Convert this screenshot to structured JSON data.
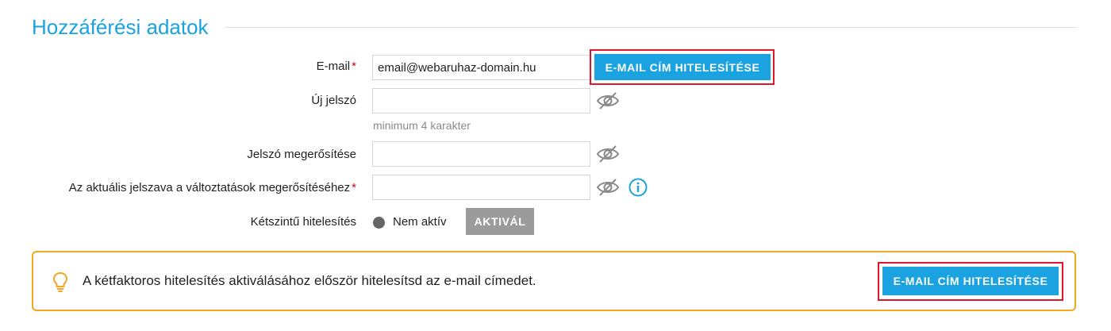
{
  "section": {
    "title": "Hozzáférési adatok"
  },
  "form": {
    "email": {
      "label": "E-mail",
      "required_mark": "*",
      "value": "email@webaruhaz-domain.hu",
      "verify_button": "E-MAIL CÍM HITELESÍTÉSE"
    },
    "new_password": {
      "label": "Új jelszó",
      "value": "",
      "hint": "minimum 4 karakter",
      "toggle_icon": "eye-slash-icon"
    },
    "confirm_password": {
      "label": "Jelszó megerősítése",
      "value": "",
      "toggle_icon": "eye-slash-icon"
    },
    "current_password": {
      "label": "Az aktuális jelszava a változtatások megerősítéséhez",
      "required_mark": "*",
      "value": "",
      "toggle_icon": "eye-slash-icon",
      "info_icon": "info-icon"
    },
    "two_factor": {
      "label": "Kétszintű hitelesítés",
      "status": "Nem aktív",
      "activate_button": "AKTIVÁL"
    }
  },
  "notice": {
    "icon": "lightbulb-icon",
    "text": "A kétfaktoros hitelesítés aktiválásához először hitelesítsd az e-mail címedet.",
    "button": "E-MAIL CÍM HITELESÍTÉSE"
  },
  "colors": {
    "accent": "#1aa3e0",
    "required": "#d0021b",
    "highlight_frame": "#e0162b",
    "notice_border": "#f5a623",
    "disabled_button": "#9b9b9b",
    "status_dot": "#666666"
  }
}
